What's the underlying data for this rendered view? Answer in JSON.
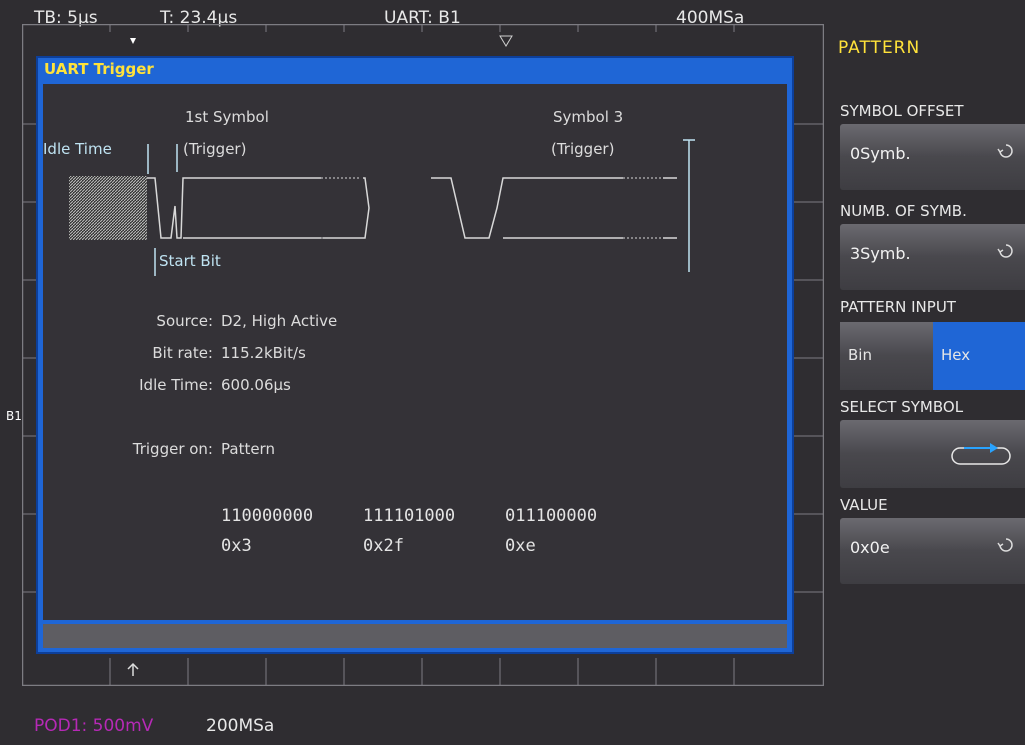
{
  "status_bar": {
    "timebase": "TB: 5µs",
    "trigger_time": "T: 23.4µs",
    "trigger_source": "UART: B1",
    "sample_rate": "400MSa"
  },
  "bottom_bar": {
    "pod": "POD1: 500mV",
    "sample_rate": "200MSa"
  },
  "channel_marker": "B1",
  "dialog": {
    "title": "UART Trigger",
    "diagram": {
      "idle_time": "Idle Time",
      "first_symbol": "1st Symbol",
      "first_trigger": "(Trigger)",
      "symbol3": "Symbol 3",
      "symbol3_trigger": "(Trigger)",
      "start_bit": "Start Bit"
    },
    "source_label": "Source:",
    "source_value": "D2, High Active",
    "bitrate_label": "Bit rate:",
    "bitrate_value": "115.2kBit/s",
    "idle_label": "Idle Time:",
    "idle_value": "600.06µs",
    "trigger_on_label": "Trigger on:",
    "trigger_on_value": "Pattern",
    "patterns": [
      {
        "bits": "110000000",
        "hex": "0x3"
      },
      {
        "bits": "111101000",
        "hex": "0x2f"
      },
      {
        "bits": "011100000",
        "hex": "0xe"
      }
    ]
  },
  "panel": {
    "title": "PATTERN",
    "symbol_offset_label": "SYMBOL OFFSET",
    "symbol_offset_value": "0Symb.",
    "numb_symb_label": "NUMB. OF SYMB.",
    "numb_symb_value": "3Symb.",
    "pattern_input_label": "PATTERN INPUT",
    "pattern_input_options": [
      "Bin",
      "Hex"
    ],
    "pattern_input_selected": "Hex",
    "select_symbol_label": "SELECT SYMBOL",
    "value_label": "VALUE",
    "value_value": "0x0e"
  },
  "colors": {
    "accent_yellow": "#ffe23a",
    "dialog_blue": "#1f66d6",
    "selected_blue": "#1f66d6",
    "pod_magenta": "#b629b6",
    "diagram_cyan": "#bfe3f2"
  }
}
